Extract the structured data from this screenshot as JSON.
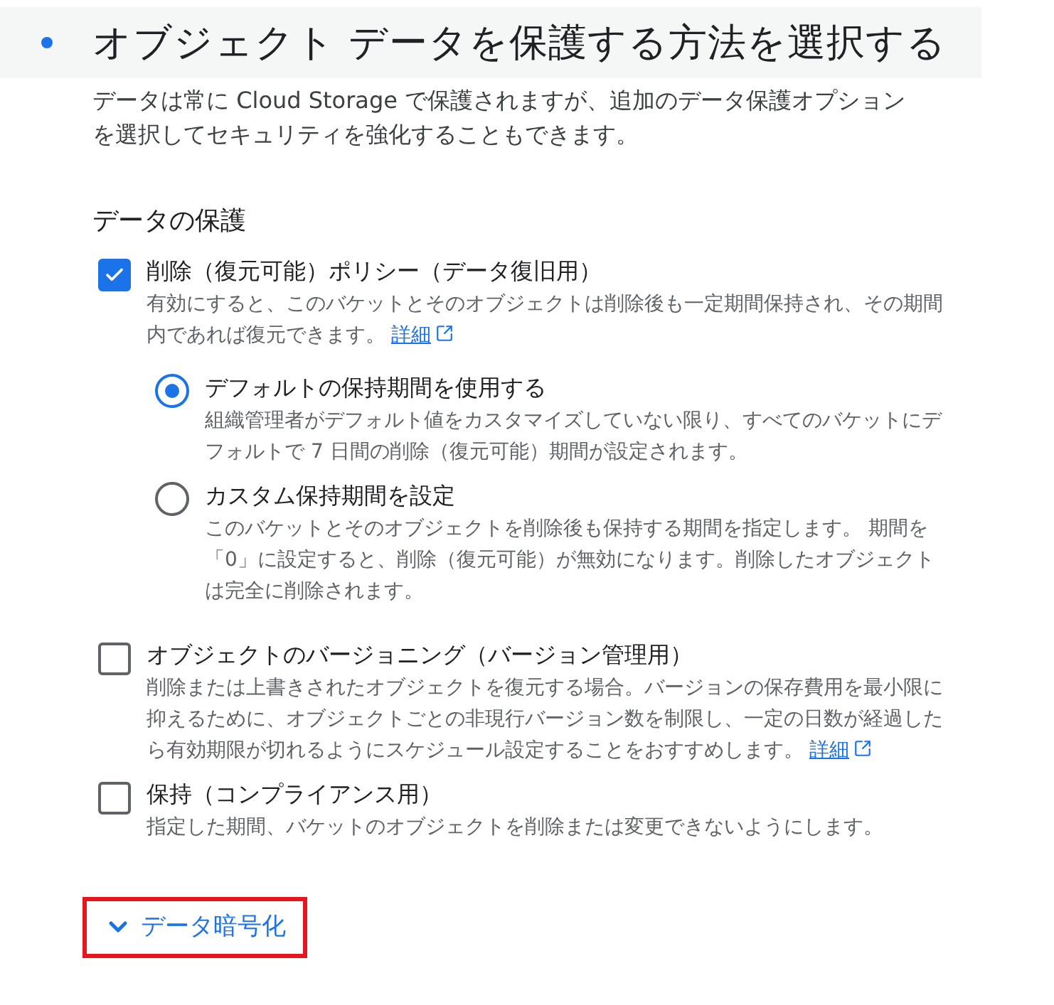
{
  "header": {
    "title": "オブジェクト データを保護する方法を選択する"
  },
  "description": "データは常に Cloud Storage で保護されますが、追加のデータ保護オプションを選択してセキュリティを強化することもできます。",
  "section_title": "データの保護",
  "options": [
    {
      "kind": "checkbox",
      "label": "削除（復元可能）ポリシー（データ復旧用）",
      "checked": true,
      "description": "有効にすると、このバケットとそのオブジェクトは削除後も一定期間保持され、その期間内であれば復元できます。",
      "link": "詳細",
      "children": [
        {
          "kind": "radio",
          "label": "デフォルトの保持期間を使用する",
          "selected": true,
          "description": "組織管理者がデフォルト値をカスタマイズしていない限り、すべてのバケットにデフォルトで 7 日間の削除（復元可能）期間が設定されます。"
        },
        {
          "kind": "radio",
          "label": "カスタム保持期間を設定",
          "selected": false,
          "description": "このバケットとそのオブジェクトを削除後も保持する期間を指定します。 期間を「0」に設定すると、削除（復元可能）が無効になります。削除したオブジェクトは完全に削除されます。"
        }
      ]
    },
    {
      "kind": "checkbox",
      "label": "オブジェクトのバージョニング（バージョン管理用）",
      "checked": false,
      "description": "削除または上書きされたオブジェクトを復元する場合。バージョンの保存費用を最小限に抑えるために、オブジェクトごとの非現行バージョン数を制限し、一定の日数が経過したら有効期限が切れるようにスケジュール設定することをおすすめします。",
      "link": "詳細"
    },
    {
      "kind": "checkbox",
      "label": "保持（コンプライアンス用）",
      "checked": false,
      "description": "指定した期間、バケットのオブジェクトを削除または変更できないようにします。"
    }
  ],
  "expander": {
    "label": "データ暗号化",
    "expanded": false
  }
}
